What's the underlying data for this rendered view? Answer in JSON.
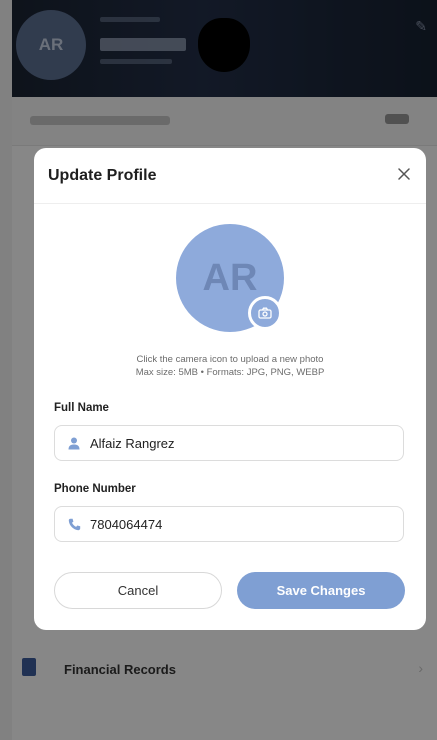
{
  "background": {
    "header": {
      "avatar_initials": "AR",
      "corner_icon": "edit-icon"
    },
    "list_items": [
      {
        "label": "Financial Records",
        "icon": "document-icon"
      }
    ]
  },
  "modal": {
    "title": "Update Profile",
    "close_icon": "close-icon",
    "avatar_initials": "AR",
    "camera_icon": "camera-icon",
    "upload_hint_line1": "Click the camera icon to upload a new photo",
    "upload_hint_line2": "Max size: 5MB • Formats: JPG, PNG, WEBP",
    "fields": {
      "full_name": {
        "label": "Full Name",
        "value": "Alfaiz Rangrez",
        "icon": "user-icon"
      },
      "phone": {
        "label": "Phone Number",
        "value": "7804064474",
        "icon": "phone-icon"
      }
    },
    "buttons": {
      "cancel": "Cancel",
      "save": "Save Changes"
    }
  },
  "colors": {
    "accent": "#7f9fd3",
    "avatar_bg": "#8eaadb",
    "icon_color": "#7f9fd3",
    "overlay": "rgba(0,0,0,0.47)"
  }
}
